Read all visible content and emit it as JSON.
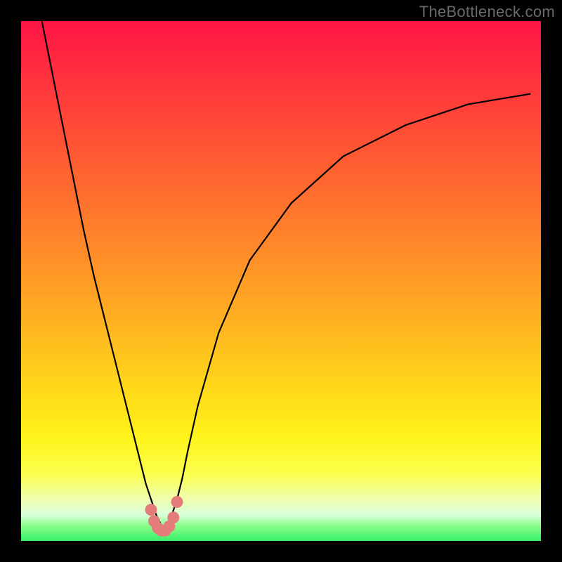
{
  "watermark": "TheBottleneck.com",
  "colors": {
    "frame_bg": "#000000",
    "curve": "#000000",
    "marker": "#e47c7c",
    "gradient_top": "#ff1545",
    "gradient_bottom": "#37f06a"
  },
  "chart_data": {
    "type": "line",
    "title": "",
    "xlabel": "",
    "ylabel": "",
    "xlim": [
      0,
      100
    ],
    "ylim": [
      0,
      100
    ],
    "grid": false,
    "series": [
      {
        "name": "bottleneck-curve",
        "x": [
          4,
          6,
          8,
          10,
          12,
          14,
          16,
          18,
          20,
          22,
          23,
          24,
          25,
          26,
          27,
          27.5,
          28,
          28.5,
          29,
          30,
          31,
          32,
          34,
          38,
          44,
          52,
          62,
          74,
          86,
          98
        ],
        "y": [
          100,
          90,
          80,
          70,
          60,
          51,
          43,
          35,
          27,
          19,
          15,
          11,
          8,
          5,
          3,
          2,
          2,
          3,
          5,
          8,
          12,
          17,
          26,
          40,
          54,
          65,
          74,
          80,
          84,
          86
        ]
      }
    ],
    "markers": {
      "name": "highlight-points",
      "x": [
        25.0,
        25.6,
        26.3,
        27.0,
        27.7,
        28.5,
        29.3,
        30.0
      ],
      "y": [
        6.0,
        3.8,
        2.5,
        2.0,
        2.0,
        2.8,
        4.5,
        7.5
      ]
    }
  }
}
